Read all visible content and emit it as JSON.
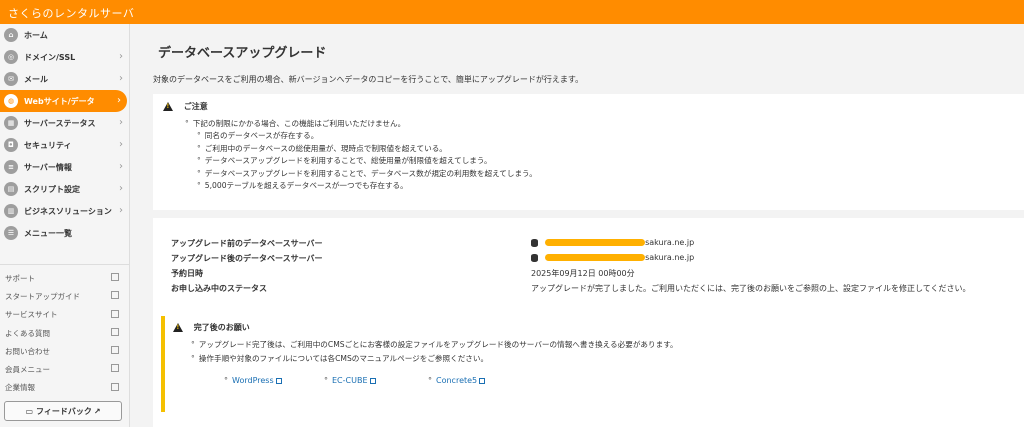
{
  "header": {
    "brand": "さくらのレンタルサーバ"
  },
  "sidebar": {
    "items": [
      {
        "label": "ホーム",
        "icon": "home-icon",
        "has_chevron": false,
        "active": false
      },
      {
        "label": "ドメイン/SSL",
        "icon": "globe-lock-icon",
        "has_chevron": true,
        "active": false
      },
      {
        "label": "メール",
        "icon": "mail-icon",
        "has_chevron": true,
        "active": false
      },
      {
        "label": "Webサイト/データ",
        "icon": "globe-icon",
        "has_chevron": true,
        "active": true
      },
      {
        "label": "サーバーステータス",
        "icon": "chart-icon",
        "has_chevron": true,
        "active": false
      },
      {
        "label": "セキュリティ",
        "icon": "lock-icon",
        "has_chevron": true,
        "active": false
      },
      {
        "label": "サーバー情報",
        "icon": "server-icon",
        "has_chevron": true,
        "active": false
      },
      {
        "label": "スクリプト設定",
        "icon": "script-icon",
        "has_chevron": true,
        "active": false
      },
      {
        "label": "ビジネスソリューション",
        "icon": "building-icon",
        "has_chevron": true,
        "active": false
      },
      {
        "label": "メニュー一覧",
        "icon": "list-icon",
        "has_chevron": false,
        "active": false
      }
    ],
    "links": [
      "サポート",
      "スタートアップガイド",
      "サービスサイト",
      "よくある質問",
      "お問い合わせ",
      "会員メニュー",
      "企業情報"
    ],
    "feedback_label": "フィードバック"
  },
  "main": {
    "title": "データベースアップグレード",
    "description": "対象のデータベースをご利用の場合、新バージョンへデータのコピーを行うことで、簡単にアップグレードが行えます。",
    "notice": {
      "heading": "ご注意",
      "intro": "下記の制限にかかる場合、この機能はご利用いただけません。",
      "items": [
        "同名のデータベースが存在する。",
        "ご利用中のデータベースの総使用量が、現時点で制限値を超えている。",
        "データベースアップグレードを利用することで、総使用量が制限値を超えてしまう。",
        "データベースアップグレードを利用することで、データベース数が規定の利用数を超えてしまう。",
        "5,000テーブルを超えるデータベースが一つでも存在する。"
      ]
    },
    "info": {
      "rows": [
        {
          "label": "アップグレード前のデータベースサーバー",
          "value": "sakura.ne.jp",
          "db_icon": true,
          "redacted": true
        },
        {
          "label": "アップグレード後のデータベースサーバー",
          "value": "sakura.ne.jp",
          "db_icon": true,
          "redacted": true
        },
        {
          "label": "予約日時",
          "value": "2025年09月12日 00時00分",
          "db_icon": false,
          "redacted": false
        },
        {
          "label": "お申し込み中のステータス",
          "value": "アップグレードが完了しました。ご利用いただくには、完了後のお願いをご参照の上、設定ファイルを修正してください。",
          "db_icon": false,
          "redacted": false
        }
      ]
    },
    "after": {
      "heading": "完了後のお願い",
      "items": [
        "アップグレード完了後は、ご利用中のCMSごとにお客様の設定ファイルをアップグレード後のサーバーの情報へ書き換える必要があります。",
        "操作手順や対象のファイルについては各CMSのマニュアルページをご参照ください。"
      ],
      "links": [
        "WordPress",
        "EC-CUBE",
        "Concrete5"
      ]
    }
  },
  "colors": {
    "brand": "#ff8c00",
    "warning": "#f5c000",
    "link": "#1a6fb3"
  }
}
